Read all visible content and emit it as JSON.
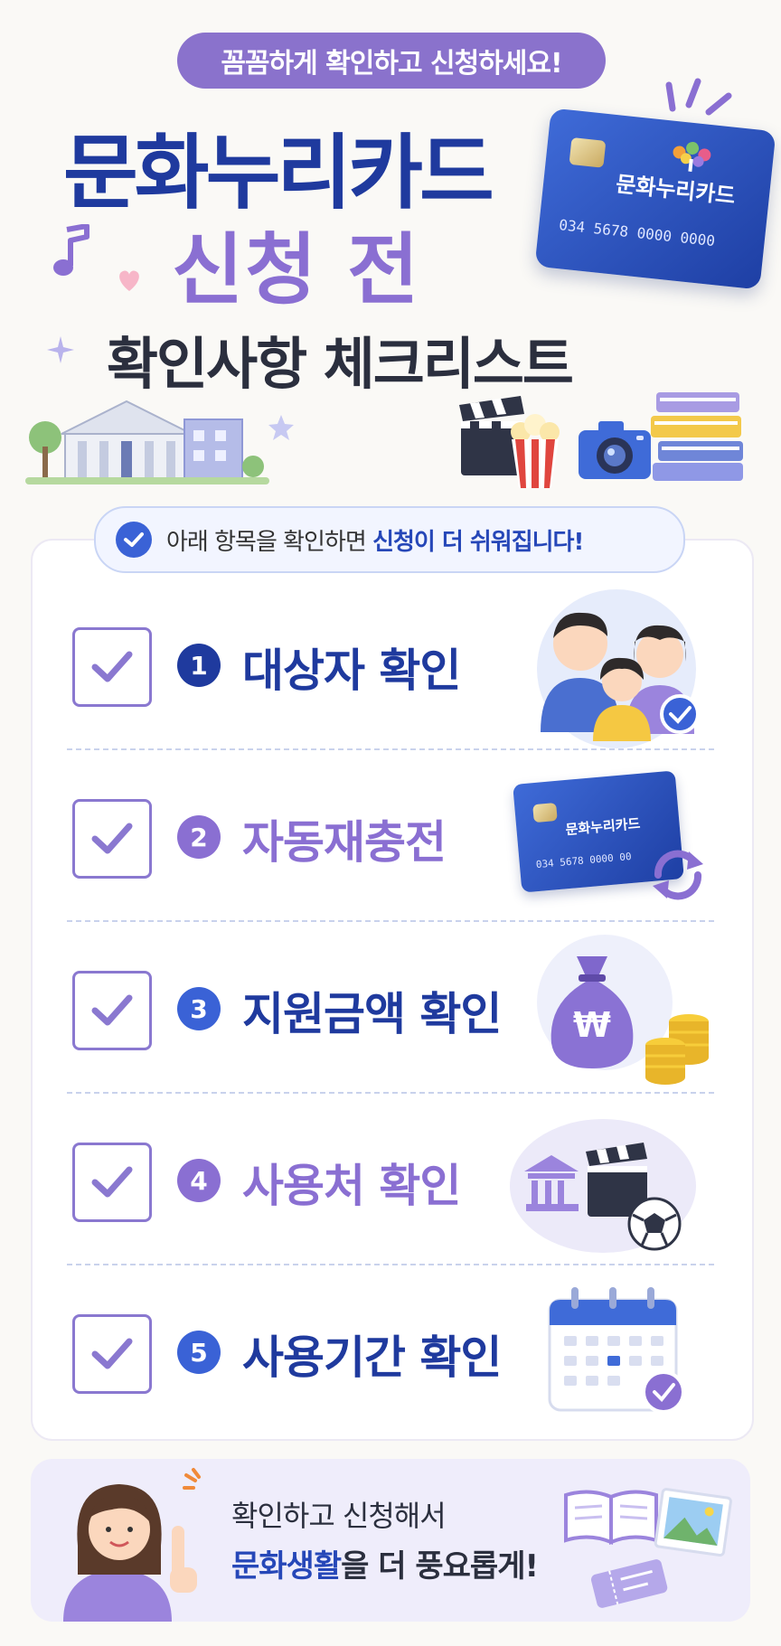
{
  "header": {
    "pill": "꼼꼼하게 확인하고 신청하세요!",
    "title_line1": "문화누리카드",
    "title_line2": "신청 전",
    "title_line3": "확인사항 체크리스트"
  },
  "card": {
    "brand": "문화누리카드",
    "number": "034 5678 0000 0000"
  },
  "notice": {
    "text_before": "아래 항목을 확인하면 ",
    "text_highlight": "신청이 더 쉬워집니다!"
  },
  "checklist": [
    {
      "num": "1",
      "label": "대상자 확인",
      "color": "#1f3a9e",
      "icon": "family-icon"
    },
    {
      "num": "2",
      "label": "자동재충전",
      "color": "#8a6fd2",
      "icon": "card-refresh-icon"
    },
    {
      "num": "3",
      "label": "지원금액 확인",
      "color": "#1f3a9e",
      "icon": "money-bag-icon"
    },
    {
      "num": "4",
      "label": "사용처 확인",
      "color": "#8a6fd2",
      "icon": "venues-icon"
    },
    {
      "num": "5",
      "label": "사용기간 확인",
      "color": "#1f3a9e",
      "icon": "calendar-icon"
    }
  ],
  "mini_card": {
    "brand": "문화누리카드",
    "number": "034 5678 0000 00"
  },
  "money_symbol": "₩",
  "footer": {
    "line1": "확인하고 신청해서",
    "line2_highlight": "문화생활",
    "line2_rest": "을 더 풍요롭게!"
  },
  "colors": {
    "navy": "#1f3a9e",
    "purple": "#8a6fd2",
    "accent_blue": "#3a62d6"
  }
}
